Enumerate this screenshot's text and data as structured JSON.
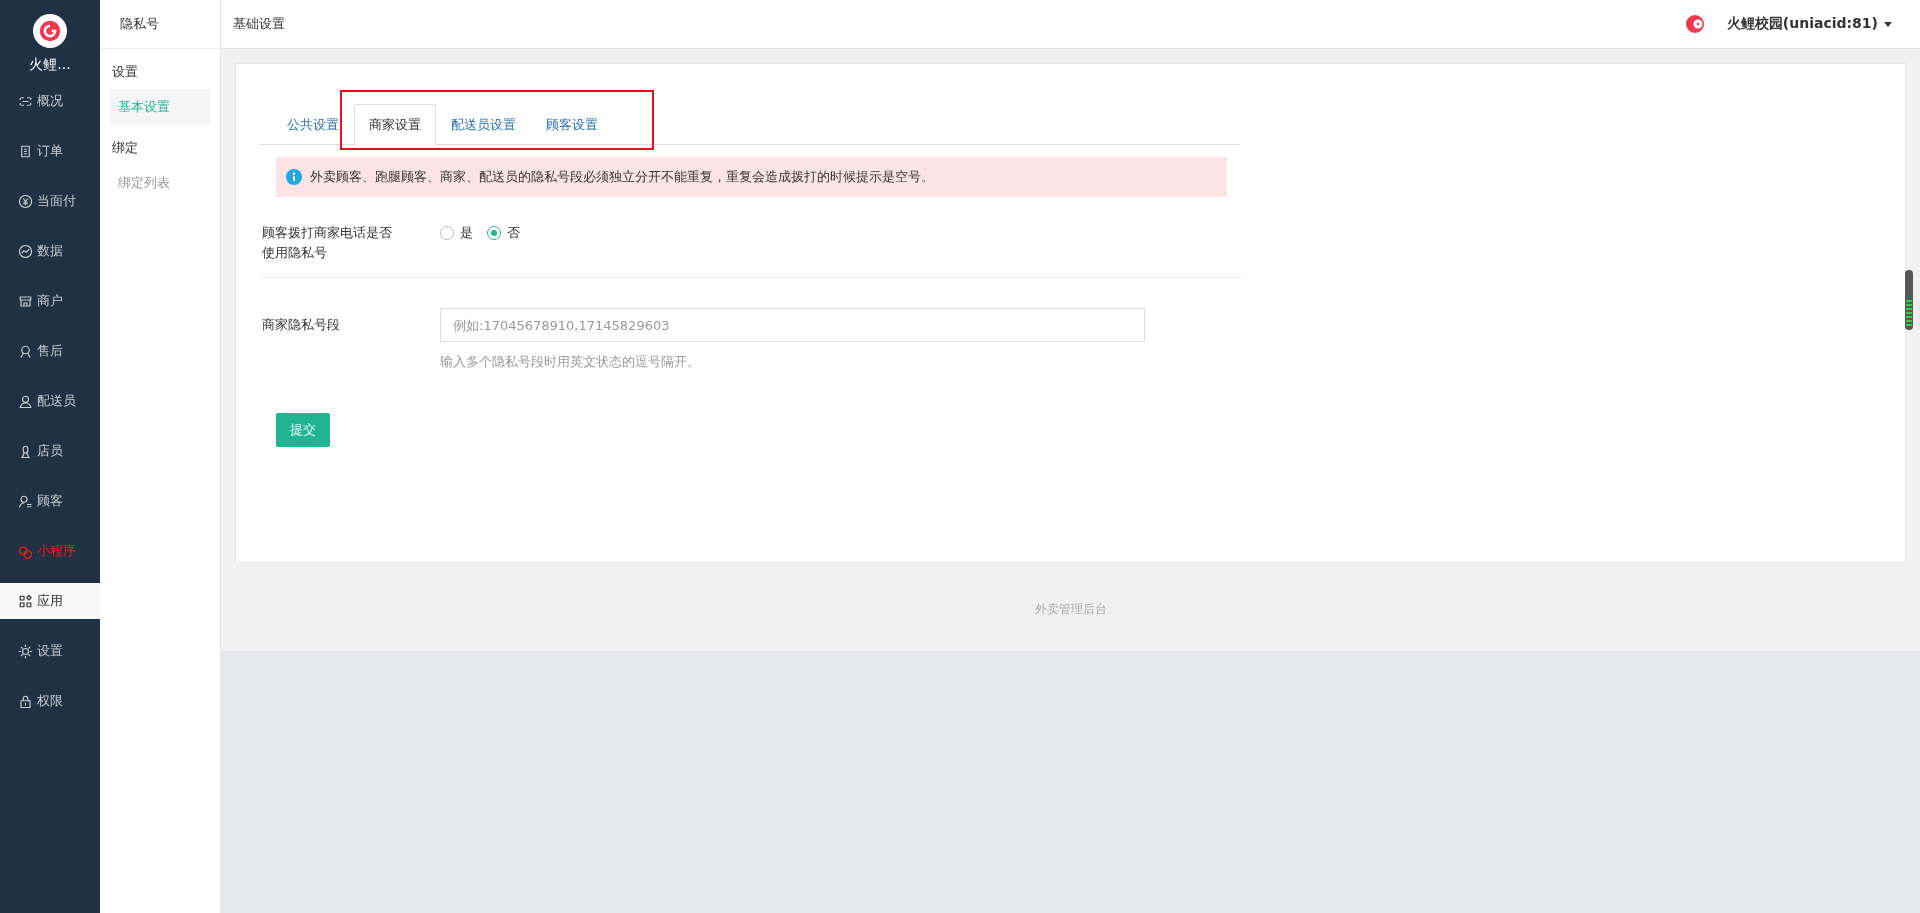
{
  "brand": {
    "name": "火鲤..."
  },
  "nav": [
    {
      "label": "概况",
      "selected": false,
      "highlighted": false
    },
    {
      "label": "订单",
      "selected": false,
      "highlighted": false
    },
    {
      "label": "当面付",
      "selected": false,
      "highlighted": false
    },
    {
      "label": "数据",
      "selected": false,
      "highlighted": false
    },
    {
      "label": "商户",
      "selected": false,
      "highlighted": false
    },
    {
      "label": "售后",
      "selected": false,
      "highlighted": false
    },
    {
      "label": "配送员",
      "selected": false,
      "highlighted": false
    },
    {
      "label": "店员",
      "selected": false,
      "highlighted": false
    },
    {
      "label": "顾客",
      "selected": false,
      "highlighted": false
    },
    {
      "label": "小程序",
      "selected": false,
      "highlighted": true
    },
    {
      "label": "应用",
      "selected": true,
      "highlighted": false
    },
    {
      "label": "设置",
      "selected": false,
      "highlighted": false
    },
    {
      "label": "权限",
      "selected": false,
      "highlighted": false
    }
  ],
  "submenu": {
    "title": "隐私号",
    "groups": [
      {
        "heading": "设置",
        "items": [
          {
            "label": "基本设置",
            "selected": true
          }
        ]
      },
      {
        "heading": "绑定",
        "items": [
          {
            "label": "绑定列表",
            "selected": false
          }
        ]
      }
    ]
  },
  "header": {
    "title": "基础设置",
    "account": "火鲤校园(uniacid:81)"
  },
  "tabs": [
    {
      "label": "公共设置",
      "selected": false
    },
    {
      "label": "商家设置",
      "selected": true
    },
    {
      "label": "配送员设置",
      "selected": false
    },
    {
      "label": "顾客设置",
      "selected": false
    }
  ],
  "alert": "外卖顾客、跑腿顾客、商家、配送员的隐私号段必须独立分开不能重复，重复会造成拨打的时候提示是空号。",
  "form": {
    "radio_field": {
      "label": "顾客拨打商家电话是否使用隐私号",
      "options": [
        {
          "label": "是",
          "selected": false
        },
        {
          "label": "否",
          "selected": true
        }
      ]
    },
    "text_field": {
      "label": "商家隐私号段",
      "placeholder": "例如:17045678910,17145829603",
      "help": "输入多个隐私号段时用英文状态的逗号隔开。"
    },
    "submit": "提交"
  },
  "footer": "外卖管理后台"
}
